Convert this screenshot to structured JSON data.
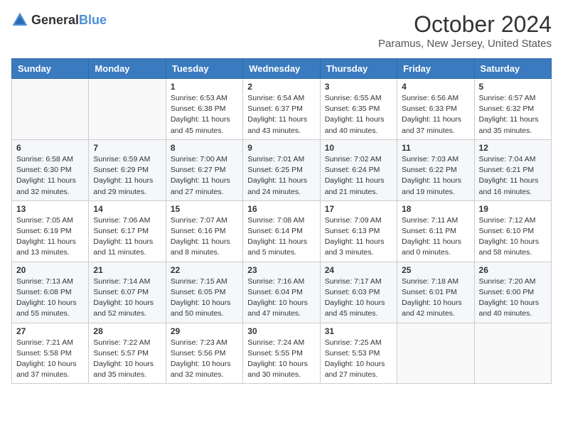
{
  "header": {
    "logo_general": "General",
    "logo_blue": "Blue",
    "month": "October 2024",
    "location": "Paramus, New Jersey, United States"
  },
  "weekdays": [
    "Sunday",
    "Monday",
    "Tuesday",
    "Wednesday",
    "Thursday",
    "Friday",
    "Saturday"
  ],
  "weeks": [
    [
      {
        "day": "",
        "content": ""
      },
      {
        "day": "",
        "content": ""
      },
      {
        "day": "1",
        "content": "Sunrise: 6:53 AM\nSunset: 6:38 PM\nDaylight: 11 hours and 45 minutes."
      },
      {
        "day": "2",
        "content": "Sunrise: 6:54 AM\nSunset: 6:37 PM\nDaylight: 11 hours and 43 minutes."
      },
      {
        "day": "3",
        "content": "Sunrise: 6:55 AM\nSunset: 6:35 PM\nDaylight: 11 hours and 40 minutes."
      },
      {
        "day": "4",
        "content": "Sunrise: 6:56 AM\nSunset: 6:33 PM\nDaylight: 11 hours and 37 minutes."
      },
      {
        "day": "5",
        "content": "Sunrise: 6:57 AM\nSunset: 6:32 PM\nDaylight: 11 hours and 35 minutes."
      }
    ],
    [
      {
        "day": "6",
        "content": "Sunrise: 6:58 AM\nSunset: 6:30 PM\nDaylight: 11 hours and 32 minutes."
      },
      {
        "day": "7",
        "content": "Sunrise: 6:59 AM\nSunset: 6:29 PM\nDaylight: 11 hours and 29 minutes."
      },
      {
        "day": "8",
        "content": "Sunrise: 7:00 AM\nSunset: 6:27 PM\nDaylight: 11 hours and 27 minutes."
      },
      {
        "day": "9",
        "content": "Sunrise: 7:01 AM\nSunset: 6:25 PM\nDaylight: 11 hours and 24 minutes."
      },
      {
        "day": "10",
        "content": "Sunrise: 7:02 AM\nSunset: 6:24 PM\nDaylight: 11 hours and 21 minutes."
      },
      {
        "day": "11",
        "content": "Sunrise: 7:03 AM\nSunset: 6:22 PM\nDaylight: 11 hours and 19 minutes."
      },
      {
        "day": "12",
        "content": "Sunrise: 7:04 AM\nSunset: 6:21 PM\nDaylight: 11 hours and 16 minutes."
      }
    ],
    [
      {
        "day": "13",
        "content": "Sunrise: 7:05 AM\nSunset: 6:19 PM\nDaylight: 11 hours and 13 minutes."
      },
      {
        "day": "14",
        "content": "Sunrise: 7:06 AM\nSunset: 6:17 PM\nDaylight: 11 hours and 11 minutes."
      },
      {
        "day": "15",
        "content": "Sunrise: 7:07 AM\nSunset: 6:16 PM\nDaylight: 11 hours and 8 minutes."
      },
      {
        "day": "16",
        "content": "Sunrise: 7:08 AM\nSunset: 6:14 PM\nDaylight: 11 hours and 5 minutes."
      },
      {
        "day": "17",
        "content": "Sunrise: 7:09 AM\nSunset: 6:13 PM\nDaylight: 11 hours and 3 minutes."
      },
      {
        "day": "18",
        "content": "Sunrise: 7:11 AM\nSunset: 6:11 PM\nDaylight: 11 hours and 0 minutes."
      },
      {
        "day": "19",
        "content": "Sunrise: 7:12 AM\nSunset: 6:10 PM\nDaylight: 10 hours and 58 minutes."
      }
    ],
    [
      {
        "day": "20",
        "content": "Sunrise: 7:13 AM\nSunset: 6:08 PM\nDaylight: 10 hours and 55 minutes."
      },
      {
        "day": "21",
        "content": "Sunrise: 7:14 AM\nSunset: 6:07 PM\nDaylight: 10 hours and 52 minutes."
      },
      {
        "day": "22",
        "content": "Sunrise: 7:15 AM\nSunset: 6:05 PM\nDaylight: 10 hours and 50 minutes."
      },
      {
        "day": "23",
        "content": "Sunrise: 7:16 AM\nSunset: 6:04 PM\nDaylight: 10 hours and 47 minutes."
      },
      {
        "day": "24",
        "content": "Sunrise: 7:17 AM\nSunset: 6:03 PM\nDaylight: 10 hours and 45 minutes."
      },
      {
        "day": "25",
        "content": "Sunrise: 7:18 AM\nSunset: 6:01 PM\nDaylight: 10 hours and 42 minutes."
      },
      {
        "day": "26",
        "content": "Sunrise: 7:20 AM\nSunset: 6:00 PM\nDaylight: 10 hours and 40 minutes."
      }
    ],
    [
      {
        "day": "27",
        "content": "Sunrise: 7:21 AM\nSunset: 5:58 PM\nDaylight: 10 hours and 37 minutes."
      },
      {
        "day": "28",
        "content": "Sunrise: 7:22 AM\nSunset: 5:57 PM\nDaylight: 10 hours and 35 minutes."
      },
      {
        "day": "29",
        "content": "Sunrise: 7:23 AM\nSunset: 5:56 PM\nDaylight: 10 hours and 32 minutes."
      },
      {
        "day": "30",
        "content": "Sunrise: 7:24 AM\nSunset: 5:55 PM\nDaylight: 10 hours and 30 minutes."
      },
      {
        "day": "31",
        "content": "Sunrise: 7:25 AM\nSunset: 5:53 PM\nDaylight: 10 hours and 27 minutes."
      },
      {
        "day": "",
        "content": ""
      },
      {
        "day": "",
        "content": ""
      }
    ]
  ]
}
